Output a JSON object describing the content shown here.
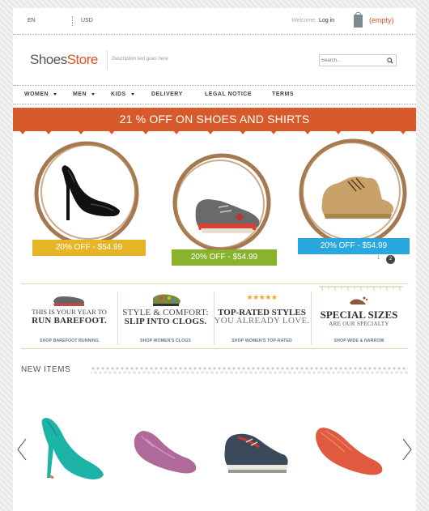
{
  "topbar": {
    "language": "EN",
    "currency": "USD",
    "welcome": "Welcome,",
    "login": "Log in",
    "cart": "(empty)"
  },
  "header": {
    "logo_part1": "Shoes",
    "logo_part2": "Store",
    "tagline": "Description text goes here",
    "search_placeholder": "Search..."
  },
  "nav": {
    "items": [
      {
        "label": "WOMEN",
        "dropdown": true
      },
      {
        "label": "MEN",
        "dropdown": true
      },
      {
        "label": "KIDS",
        "dropdown": true
      },
      {
        "label": "DELIVERY",
        "dropdown": false
      },
      {
        "label": "LEGAL NOTICE",
        "dropdown": false
      },
      {
        "label": "TERMS",
        "dropdown": false
      }
    ]
  },
  "banner": {
    "text": "21 % OFF ON SHOES AND SHIRTS"
  },
  "slider": {
    "items": [
      {
        "price": "20% OFF - $54.99",
        "ribbon_color": "#e6b526",
        "product": "black patent pump"
      },
      {
        "price": "20% OFF - $54.99",
        "ribbon_color": "#89b32c",
        "product": "grey kids sneaker"
      },
      {
        "price": "20% OFF - $54.99",
        "ribbon_color": "#2aa8de",
        "product": "tan suede chukka boot"
      }
    ],
    "pages": [
      "1",
      "2"
    ],
    "current_page": "2"
  },
  "promos": [
    {
      "line1": "THIS IS YOUR YEAR TO",
      "line2": "RUN BAREFOOT.",
      "link": "SHOP BAREFOOT RUNNING"
    },
    {
      "line1": "STYLE & COMFORT:",
      "line2": "SLIP INTO CLOGS.",
      "link": "SHOP WOMEN'S CLOGS"
    },
    {
      "line1": "TOP-RATED STYLES",
      "line2": "YOU ALREADY LOVE.",
      "link": "SHOP WOMEN'S TOP-RATED",
      "stars": "★★★★★"
    },
    {
      "line1": "SPECIAL SIZES",
      "line2": "ARE OUR SPECIALTY",
      "link": "SHOP WIDE & NARROW"
    }
  ],
  "new_items": {
    "title": "NEW ITEMS",
    "products": [
      "teal pump",
      "pink woven flat",
      "navy boat shoe",
      "red woven flat"
    ]
  },
  "colors": {
    "accent": "#e0522a",
    "banner": "#d85a2b"
  }
}
